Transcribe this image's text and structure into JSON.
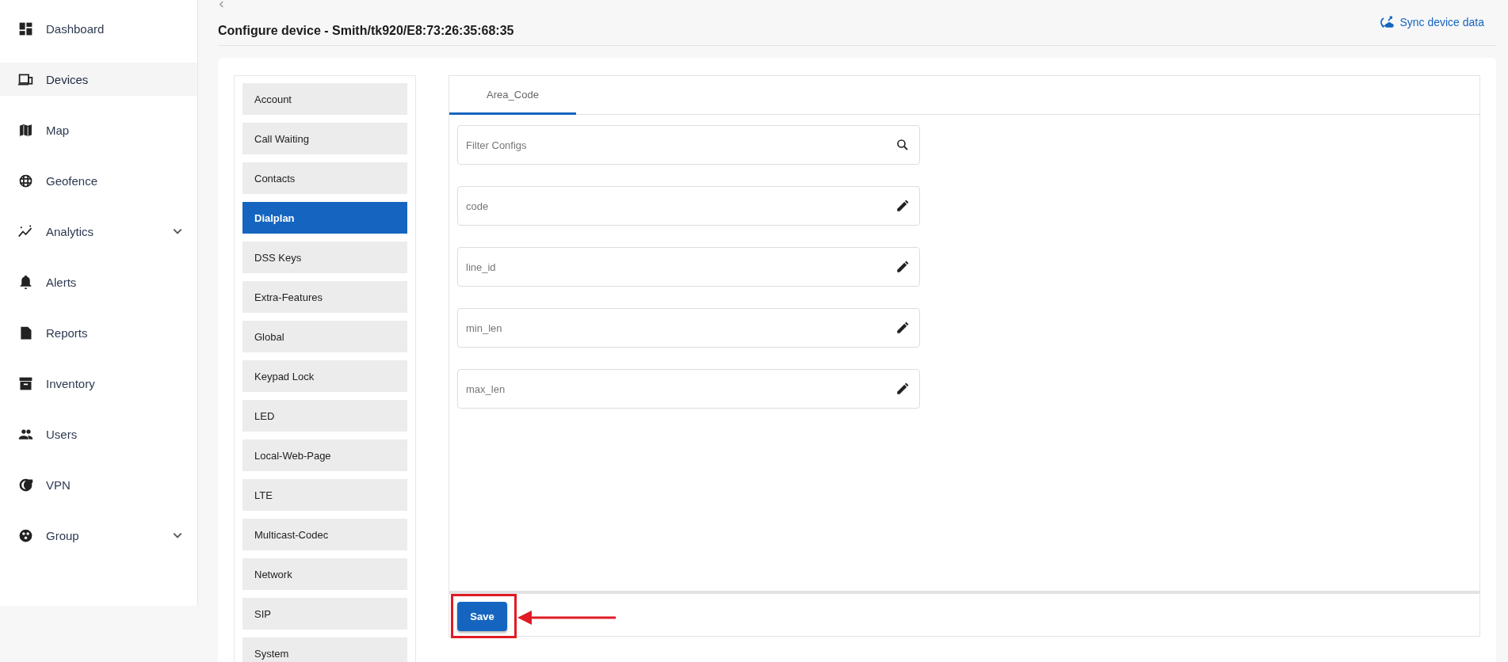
{
  "sidebar": {
    "items": [
      {
        "label": "Dashboard",
        "selected": false,
        "expandable": false
      },
      {
        "label": "Devices",
        "selected": true,
        "expandable": false
      },
      {
        "label": "Map",
        "selected": false,
        "expandable": false
      },
      {
        "label": "Geofence",
        "selected": false,
        "expandable": false
      },
      {
        "label": "Analytics",
        "selected": false,
        "expandable": true
      },
      {
        "label": "Alerts",
        "selected": false,
        "expandable": false
      },
      {
        "label": "Reports",
        "selected": false,
        "expandable": false
      },
      {
        "label": "Inventory",
        "selected": false,
        "expandable": false
      },
      {
        "label": "Users",
        "selected": false,
        "expandable": false
      },
      {
        "label": "VPN",
        "selected": false,
        "expandable": false
      },
      {
        "label": "Group",
        "selected": false,
        "expandable": true
      }
    ]
  },
  "header": {
    "title": "Configure device - Smith/tk920/E8:73:26:35:68:35",
    "sync_link": "Sync device data"
  },
  "config_sections": [
    {
      "label": "Account",
      "selected": false
    },
    {
      "label": "Call Waiting",
      "selected": false
    },
    {
      "label": "Contacts",
      "selected": false
    },
    {
      "label": "Dialplan",
      "selected": true
    },
    {
      "label": "DSS Keys",
      "selected": false
    },
    {
      "label": "Extra-Features",
      "selected": false
    },
    {
      "label": "Global",
      "selected": false
    },
    {
      "label": "Keypad Lock",
      "selected": false
    },
    {
      "label": "LED",
      "selected": false
    },
    {
      "label": "Local-Web-Page",
      "selected": false
    },
    {
      "label": "LTE",
      "selected": false
    },
    {
      "label": "Multicast-Codec",
      "selected": false
    },
    {
      "label": "Network",
      "selected": false
    },
    {
      "label": "SIP",
      "selected": false
    },
    {
      "label": "System",
      "selected": false
    }
  ],
  "tabs": [
    {
      "label": "Area_Code",
      "selected": true
    }
  ],
  "filter": {
    "placeholder": "Filter Configs"
  },
  "fields": [
    {
      "placeholder": "code"
    },
    {
      "placeholder": "line_id"
    },
    {
      "placeholder": "min_len"
    },
    {
      "placeholder": "max_len"
    }
  ],
  "save_button": "Save"
}
